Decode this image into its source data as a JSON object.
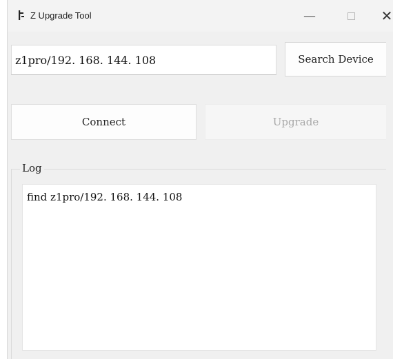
{
  "window": {
    "title": "Z Upgrade Tool",
    "minimize_glyph": "—",
    "close_glyph": "✕",
    "icon": "z-app-icon"
  },
  "device": {
    "value": "z1pro/192. 168. 144. 108",
    "search_label": "Search Device"
  },
  "actions": {
    "connect_label": "Connect",
    "upgrade_label": "Upgrade",
    "upgrade_enabled": false
  },
  "log": {
    "label": "Log",
    "lines": [
      "find z1pro/192. 168. 144. 108"
    ]
  },
  "colors": {
    "window_bg": "#f0f0f0",
    "disabled_text": "#a8a8a8"
  }
}
